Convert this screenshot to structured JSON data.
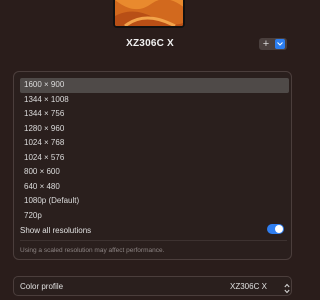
{
  "display": {
    "name": "XZ306C X"
  },
  "toolbar": {
    "add_label": "+"
  },
  "resolutions": {
    "items": [
      "1600 × 900",
      "1344 × 1008",
      "1344 × 756",
      "1280 × 960",
      "1024 × 768",
      "1024 × 576",
      "800 × 600",
      "640 × 480",
      "1080p (Default)",
      "720p"
    ],
    "selected_index": 0,
    "show_all_label": "Show all resolutions",
    "show_all_on": true,
    "note": "Using a scaled resolution may affect performance."
  },
  "color_profile": {
    "label": "Color profile",
    "value": "XZ306C X"
  },
  "colors": {
    "accent": "#2f7ef0",
    "background": "#2a1d1b",
    "selection": "#4f4a48"
  }
}
